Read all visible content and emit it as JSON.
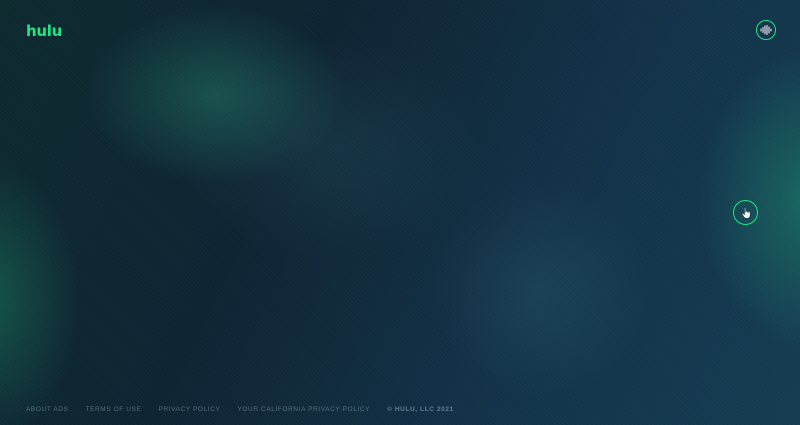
{
  "header": {
    "logo_text": "hulu",
    "audio_icon": "sound-wave-icon"
  },
  "main": {
    "cursor_icon": "pointer-hand-icon"
  },
  "footer": {
    "links": [
      "ABOUT ADS",
      "TERMS OF USE",
      "PRIVACY POLICY",
      "YOUR CALIFORNIA PRIVACY POLICY"
    ],
    "copyright": "© HULU, LLC 2021"
  },
  "colors": {
    "brand_green": "#1ce783",
    "background": "#0f2836"
  }
}
